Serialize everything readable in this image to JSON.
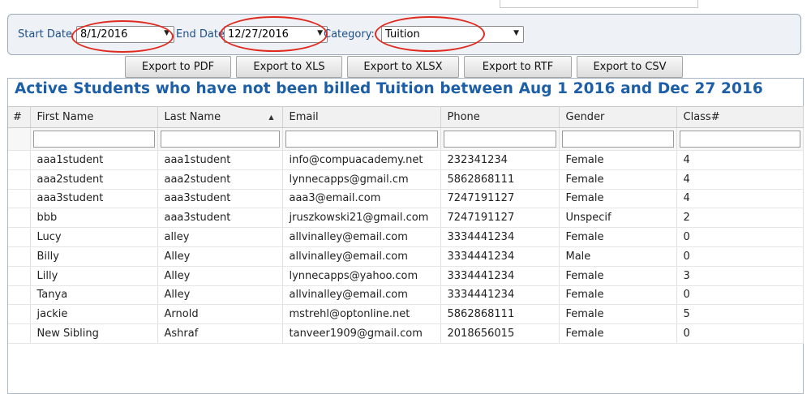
{
  "filters": {
    "start_date_label": "Start Date",
    "start_date_value": "8/1/2016",
    "end_date_label": "End Date",
    "end_date_value": "12/27/2016",
    "category_label": "Category:",
    "category_value": "Tuition"
  },
  "export_buttons": [
    "Export to PDF",
    "Export to XLS",
    "Export to XLSX",
    "Export to RTF",
    "Export to CSV"
  ],
  "report": {
    "title": "Active Students who have not been billed Tuition between Aug 1 2016 and Dec 27 2016",
    "columns": [
      "#",
      "First Name",
      "Last Name",
      "Email",
      "Phone",
      "Gender",
      "Class#"
    ],
    "rows": [
      [
        "",
        "aaa1student",
        "aaa1student",
        "info@compuacademy.net",
        "232341234",
        "Female",
        "4"
      ],
      [
        "",
        "aaa2student",
        "aaa2student",
        "lynnecapps@gmail.cm",
        "5862868111",
        "Female",
        "4"
      ],
      [
        "",
        "aaa3student",
        "aaa3student",
        "aaa3@email.com",
        "7247191127",
        "Female",
        "4"
      ],
      [
        "",
        "bbb",
        "aaa3student",
        "jruszkowski21@gmail.com",
        "7247191127",
        "Unspecif",
        "2"
      ],
      [
        "",
        "Lucy",
        "alley",
        "allvinalley@email.com",
        "3334441234",
        "Female",
        "0"
      ],
      [
        "",
        "Billy",
        "Alley",
        "allvinalley@email.com",
        "3334441234",
        "Male",
        "0"
      ],
      [
        "",
        "Lilly",
        "Alley",
        "lynnecapps@yahoo.com",
        "3334441234",
        "Female",
        "3"
      ],
      [
        "",
        "Tanya",
        "Alley",
        "allvinalley@email.com",
        "3334441234",
        "Female",
        "0"
      ],
      [
        "",
        "jackie",
        "Arnold",
        "mstrehl@optonline.net",
        "5862868111",
        "Female",
        "5"
      ],
      [
        "",
        "New Sibling",
        "Ashraf",
        "tanveer1909@gmail.com",
        "2018656015",
        "Female",
        "0"
      ]
    ]
  },
  "colors": {
    "accent": "#1d5fa6",
    "label": "#1d4f8c",
    "highlight_ring": "#e02a1f"
  }
}
